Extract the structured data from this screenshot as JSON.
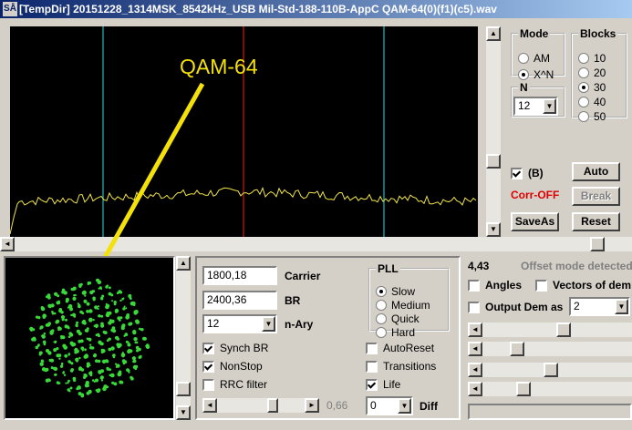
{
  "window": {
    "title": "[TempDir] 20151228_1314MSK_8542kHz_USB Mil-Std-188-110B-AppC QAM-64(0)(f1)(c5).wav",
    "icon_text": "SÅ"
  },
  "annotation": {
    "label": "QAM-64",
    "color": "#f5e10a"
  },
  "mode": {
    "legend": "Mode",
    "options": [
      {
        "label": "AM",
        "selected": false
      },
      {
        "label": "X^N",
        "selected": true
      }
    ]
  },
  "blocks": {
    "legend": "Blocks",
    "options": [
      {
        "label": "10",
        "selected": false
      },
      {
        "label": "20",
        "selected": false
      },
      {
        "label": "30",
        "selected": true
      },
      {
        "label": "40",
        "selected": false
      },
      {
        "label": "50",
        "selected": false
      }
    ]
  },
  "n": {
    "legend": "N",
    "value": "12"
  },
  "b_check": {
    "label": "(B)",
    "checked": true
  },
  "status": {
    "corr": "Corr-OFF",
    "corr_color": "#e00000"
  },
  "buttons": {
    "auto": "Auto",
    "break": "Break",
    "saveas": "SaveAs",
    "reset": "Reset"
  },
  "demod": {
    "carrier_value": "1800,18",
    "carrier_label": "Carrier",
    "br_value": "2400,36",
    "br_label": "BR",
    "nary_value": "12",
    "nary_label": "n-Ary",
    "synch_br": {
      "label": "Synch BR",
      "checked": true
    },
    "nonstop": {
      "label": "NonStop",
      "checked": true
    },
    "rrc": {
      "label": "RRC filter",
      "checked": false
    },
    "slider_value": "0,66",
    "diff_value": "0",
    "diff_label": "Diff"
  },
  "pll": {
    "legend": "PLL",
    "options": [
      {
        "label": "Slow",
        "selected": true
      },
      {
        "label": "Medium",
        "selected": false
      },
      {
        "label": "Quick",
        "selected": false
      },
      {
        "label": "Hard",
        "selected": false
      }
    ]
  },
  "flags": {
    "autoreset": {
      "label": "AutoReset",
      "checked": false
    },
    "transitions": {
      "label": "Transitions",
      "checked": false
    },
    "life": {
      "label": "Life",
      "checked": true
    }
  },
  "right": {
    "readout": "4,43",
    "offset_msg": "Offset mode detected",
    "angles": {
      "label": "Angles",
      "checked": false
    },
    "vectors": {
      "label": "Vectors of dem",
      "checked": false
    },
    "output_dem": {
      "label": "Output Dem as",
      "checked": false
    },
    "output_value": "2",
    "slider_levels": [
      0.55,
      0.2,
      0.45,
      0.25
    ]
  },
  "colors": {
    "trace": "#f2e64a",
    "marker_cyan": "#28b8b8",
    "marker_red": "#c81818",
    "constellation": "#3ad93a"
  }
}
